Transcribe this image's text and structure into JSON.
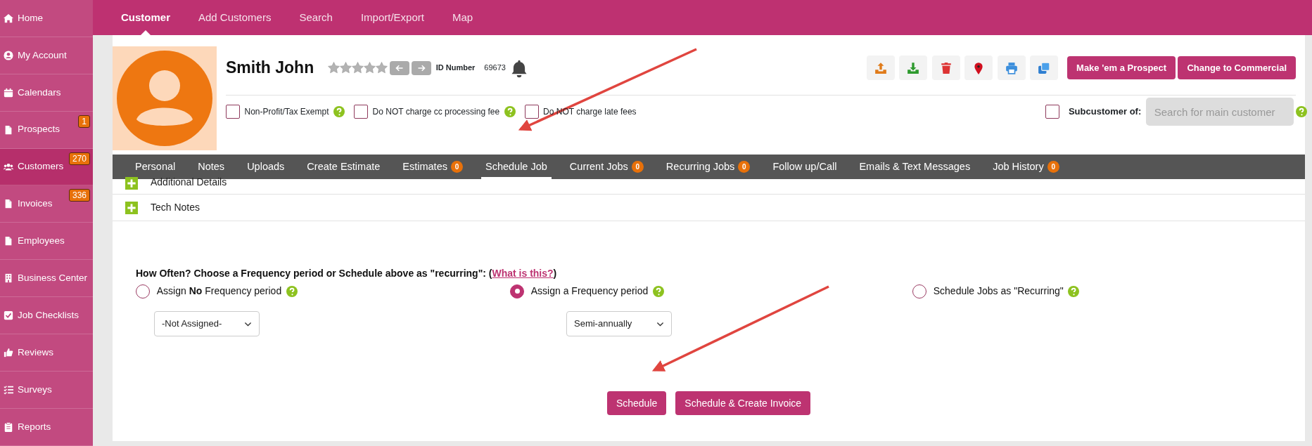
{
  "sidebar": {
    "items": [
      {
        "label": "Home",
        "selected": false
      },
      {
        "label": "My Account",
        "selected": false
      },
      {
        "label": "Calendars",
        "selected": false
      },
      {
        "label": "Prospects",
        "badge": "1",
        "selected": false
      },
      {
        "label": "Customers",
        "badge": "270",
        "selected": true
      },
      {
        "label": "Invoices",
        "badge": "336",
        "selected": false
      },
      {
        "label": "Employees",
        "selected": false
      },
      {
        "label": "Business Center",
        "selected": false
      },
      {
        "label": "Job Checklists",
        "selected": false
      },
      {
        "label": "Reviews",
        "selected": false
      },
      {
        "label": "Surveys",
        "selected": false
      },
      {
        "label": "Reports",
        "selected": false
      }
    ]
  },
  "top_nav": {
    "items": [
      {
        "label": "Customer",
        "selected": true
      },
      {
        "label": "Add Customers",
        "selected": false
      },
      {
        "label": "Search",
        "selected": false
      },
      {
        "label": "Import/Export",
        "selected": false
      },
      {
        "label": "Map",
        "selected": false
      }
    ]
  },
  "customer": {
    "name": "Smith John",
    "stars": 0,
    "id_label": "ID Number",
    "id_value": "69673"
  },
  "actions": [
    "Make 'em a Prospect",
    "Change to Commercial"
  ],
  "options": [
    {
      "label": "Non-Profit/Tax Exempt",
      "checked": false,
      "help": true
    },
    {
      "label": "Do NOT charge cc processing fee",
      "checked": false,
      "help": true
    },
    {
      "label": "Do NOT charge late fees",
      "checked": false,
      "help": false
    }
  ],
  "subcustomer": {
    "label": "Subcustomer of:",
    "checked": false,
    "placeholder": "Search for main customer"
  },
  "tabs": [
    {
      "label": "Personal",
      "selected": false
    },
    {
      "label": "Notes",
      "selected": false
    },
    {
      "label": "Uploads",
      "selected": false
    },
    {
      "label": "Create Estimate",
      "selected": false
    },
    {
      "label": "Estimates",
      "badge": "0",
      "selected": false
    },
    {
      "label": "Schedule Job",
      "selected": true
    },
    {
      "label": "Current Jobs",
      "badge": "0",
      "selected": false
    },
    {
      "label": "Recurring Jobs",
      "badge": "0",
      "selected": false
    },
    {
      "label": "Follow up/Call",
      "selected": false
    },
    {
      "label": "Emails & Text Messages",
      "selected": false
    },
    {
      "label": "Job History",
      "badge": "0",
      "selected": false
    }
  ],
  "sections": [
    "Additional Details",
    "Tech Notes"
  ],
  "frequency": {
    "prompt": "How Often? Choose a Frequency period or Schedule above as \"recurring\": (",
    "link": "What is this?",
    "prompt_end": ")",
    "choices": [
      {
        "label": "Assign **No** Frequency period",
        "selected": false,
        "select_value": "-Not Assigned-"
      },
      {
        "label": "Assign a Frequency period",
        "selected": true,
        "select_value": "Semi-annually"
      },
      {
        "label": "Schedule Jobs as \"Recurring\"",
        "selected": false
      }
    ]
  },
  "buttons": [
    "Schedule",
    "Schedule & Create Invoice"
  ]
}
